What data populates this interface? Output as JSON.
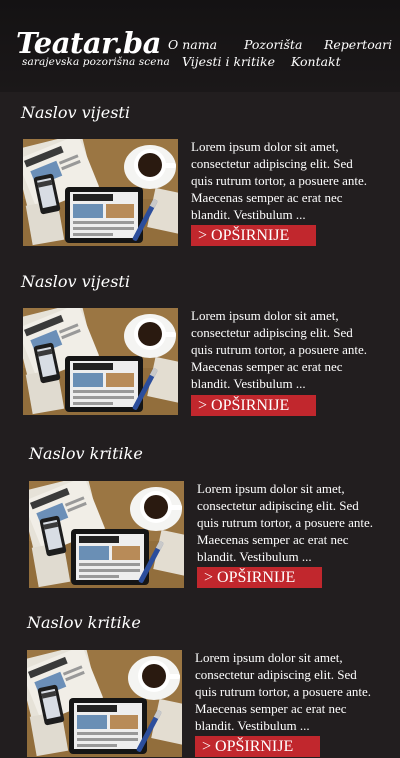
{
  "header": {
    "logo": "Teatar.ba",
    "tagline": "sarajevska pozorišna scena",
    "nav": [
      "O nama",
      "Pozorišta",
      "Repertoari",
      "Vijesti i kritike",
      "Kontakt"
    ]
  },
  "cards": [
    {
      "title": "Naslov vijesti",
      "excerpt": "Lorem ipsum dolor sit amet, consectetur adipiscing elit. Sed quis rutrum tortor, a posuere ante. Maecenas semper ac erat nec blandit. Vestibulum ...",
      "more": "> OPŠIRNIJE"
    },
    {
      "title": "Naslov vijesti",
      "excerpt": "Lorem ipsum dolor sit amet, consectetur adipiscing elit. Sed quis rutrum tortor, a posuere ante. Maecenas semper ac erat nec blandit. Vestibulum ...",
      "more": "> OPŠIRNIJE"
    },
    {
      "title": "Naslov kritike",
      "excerpt": "Lorem ipsum dolor sit amet, consectetur adipiscing elit. Sed quis rutrum tortor, a posuere ante. Maecenas semper ac erat nec blandit. Vestibulum ...",
      "more": "> OPŠIRNIJE"
    },
    {
      "title": "Naslov kritike",
      "excerpt": "Lorem ipsum dolor sit amet, consectetur adipiscing elit. Sed quis rutrum tortor, a posuere ante. Maecenas semper ac erat nec blandit. Vestibulum ...",
      "more": "> OPŠIRNIJE"
    }
  ],
  "colors": {
    "background": "#221e1f",
    "header": "#161314",
    "accent": "#c1272d"
  }
}
